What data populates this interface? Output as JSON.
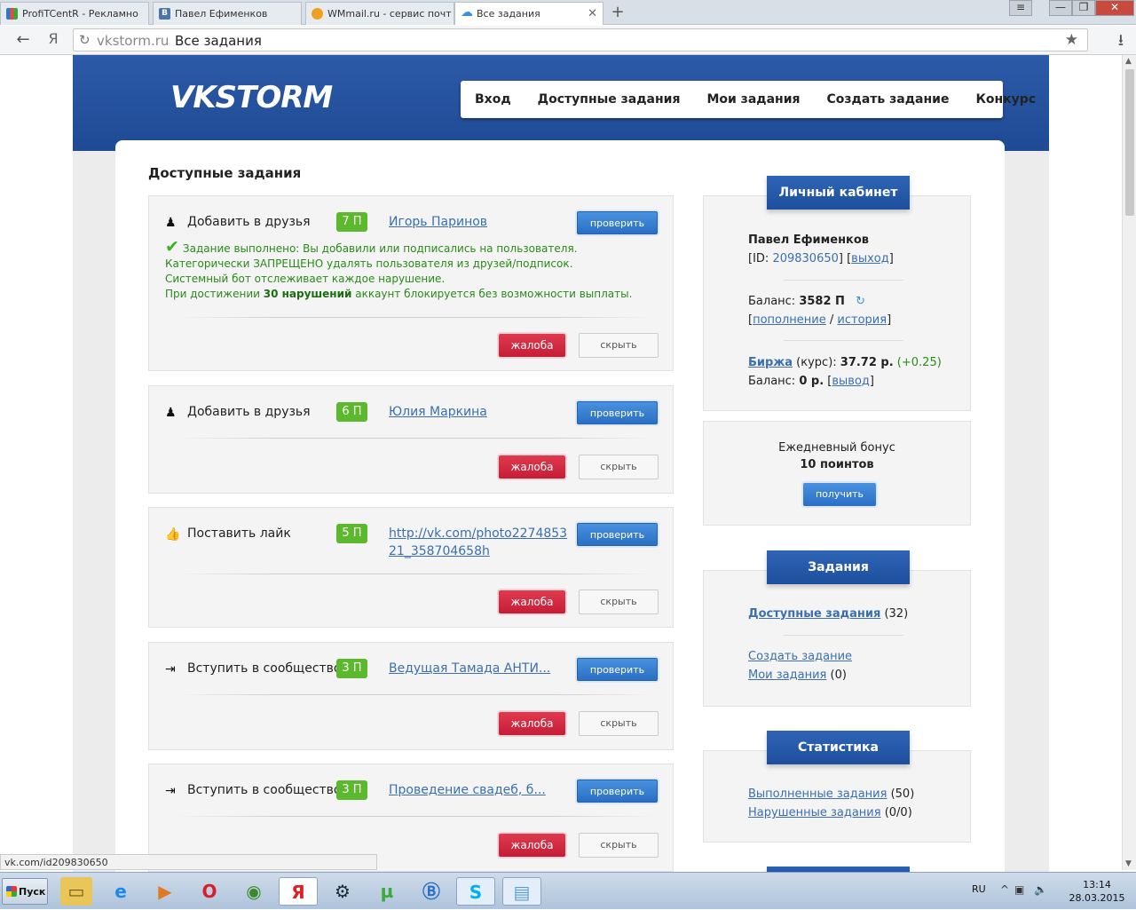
{
  "browser": {
    "tabs": [
      {
        "label": "ProfiTCentR - Рекламно",
        "icon": "bar-chart-icon",
        "color": "#2a7bd0",
        "active": false
      },
      {
        "label": "Павел Ефименков",
        "icon": "vk-icon",
        "color": "#4a76a8",
        "active": false
      },
      {
        "label": "WMmail.ru - сервис почт",
        "icon": "wmmail-icon",
        "color": "#f0a020",
        "active": false
      },
      {
        "label": "Все задания",
        "icon": "cloud-icon",
        "color": "#3a8ee6",
        "active": true
      }
    ],
    "new_tab": "+",
    "window_buttons": [
      "≡",
      "—",
      "❐",
      "✕"
    ],
    "back": "←",
    "yandex": "Я",
    "url_host": "vkstorm.ru",
    "url_title": "Все задания",
    "bookmark": "★",
    "download": "⭳"
  },
  "site": {
    "logo": "VKSTORM",
    "nav": [
      "Вход",
      "Доступные задания",
      "Мои задания",
      "Создать задание",
      "Конкурс"
    ],
    "heading": "Доступные задания"
  },
  "tasks": [
    {
      "type": "Добавить в друзья",
      "icon": "person-icon",
      "points": "7 П",
      "link": "Игорь Паринов",
      "check": "проверить",
      "complaint": "жалоба",
      "hide": "скрыть",
      "success": {
        "line1": "Задание выполнено: Вы добавили или подписались на пользователя.",
        "line2": "Категорически ЗАПРЕЩЕНО удалять пользователя из друзей/подписок.",
        "line3": "Системный бот отслеживает каждое нарушение.",
        "line4a": "При достижении ",
        "line4b": "30 нарушений",
        "line4c": " аккаунт блокируется без возможности выплаты."
      }
    },
    {
      "type": "Добавить в друзья",
      "icon": "person-icon",
      "points": "6 П",
      "link": "Юлия Маркина",
      "check": "проверить",
      "complaint": "жалоба",
      "hide": "скрыть"
    },
    {
      "type": "Поставить лайк",
      "icon": "thumbs-up-icon",
      "points": "5 П",
      "link1": "http://vk.com/photo2274853",
      "link2": "21_358704658h",
      "check": "проверить",
      "complaint": "жалоба",
      "hide": "скрыть"
    },
    {
      "type": "Вступить в сообщество",
      "icon": "join-icon",
      "points": "3 П",
      "link": "Ведущая Тамада АНТИ...",
      "check": "проверить",
      "complaint": "жалоба",
      "hide": "скрыть"
    },
    {
      "type": "Вступить в сообщество",
      "icon": "join-icon",
      "points": "3 П",
      "link": "Проведение свадеб, б...",
      "check": "проверить",
      "complaint": "жалоба",
      "hide": "скрыть"
    }
  ],
  "sidebar": {
    "cabinet": {
      "title": "Личный кабинет",
      "name": "Павел Ефименков",
      "id_prefix": "[ID: ",
      "id": "209830650",
      "id_mid": "] [",
      "logout": "выход",
      "close": "]",
      "balance_label": "Баланс: ",
      "balance": "3582 П",
      "open": "[",
      "topup": "пополнение",
      "slash": " / ",
      "history": "история",
      "exchange": "Биржа",
      "rate_label": " (курс): ",
      "rate": "37.72 р.",
      "rate_change": " (+0.25)",
      "balance2_label": "Баланс: ",
      "balance2": "0 р.",
      "withdraw": "вывод"
    },
    "bonus": {
      "line1": "Ежедневный бонус",
      "line2": "10 поинтов",
      "button": "получить"
    },
    "tasks_box": {
      "title": "Задания",
      "available": "Доступные задания",
      "available_count": " (32)",
      "create": "Создать задание",
      "mine": "Мои задания",
      "mine_count": " (0)"
    },
    "stats": {
      "title": "Статистика",
      "done": "Выполненные задания",
      "done_count": " (50)",
      "violated": "Нарушенные задания",
      "violated_count": " (0/0)"
    }
  },
  "status_url": "vk.com/id209830650",
  "taskbar": {
    "start": "Пуск",
    "apps": [
      "explorer-icon",
      "ie-icon",
      "media-icon",
      "opera-icon",
      "chrome-icon",
      "yandex-icon",
      "steam-icon",
      "utorrent-icon",
      "b-icon",
      "skype-icon",
      "notepad-icon"
    ],
    "lang": "RU",
    "time": "13:14",
    "date": "28.03.2015"
  }
}
